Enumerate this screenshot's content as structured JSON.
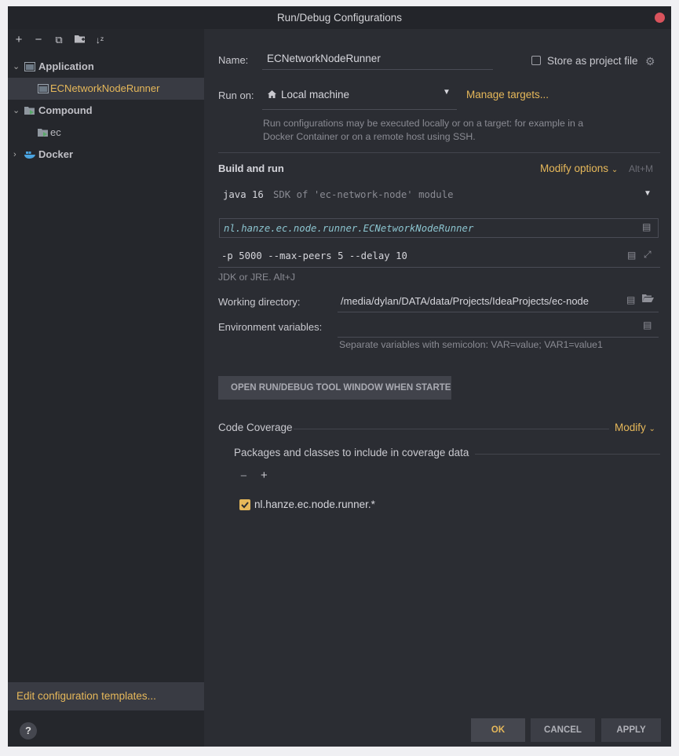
{
  "window": {
    "title": "Run/Debug Configurations"
  },
  "toolbar": {
    "add": "+",
    "remove": "−",
    "copy": "⧉",
    "folder": "▰",
    "sort": "↓ᶻ"
  },
  "tree": [
    {
      "label": "Application",
      "expanded": true
    },
    {
      "label": "ECNetworkNodeRunner",
      "selected": true
    },
    {
      "label": "Compound",
      "expanded": true
    },
    {
      "label": "ec"
    },
    {
      "label": "Docker",
      "expanded": false
    }
  ],
  "sidebar": {
    "edit_templates": "Edit configuration templates...",
    "help": "?"
  },
  "form": {
    "name_label": "Name:",
    "name_value": "ECNetworkNodeRunner",
    "store_label": "Store as project file",
    "run_on_label": "Run on:",
    "run_on_value": "Local machine",
    "manage_targets": "Manage targets...",
    "run_on_hint": "Run configurations may be executed locally or on a target: for example in a Docker Container or on a remote host using SSH.",
    "build_run_title": "Build and run",
    "modify_options": "Modify options",
    "modify_shortcut": "Alt+M",
    "jdk_value": "java 16",
    "jdk_sdk": "SDK of 'ec-network-node' module",
    "main_class": "nl.hanze.ec.node.runner.ECNetworkNodeRunner",
    "program_args": "-p 5000 --max-peers 5 --delay 10",
    "jdk_hint": "JDK or JRE. Alt+J",
    "workdir_label": "Working directory:",
    "workdir_value": "/media/dylan/DATA/data/Projects/IdeaProjects/ec-node",
    "env_label": "Environment variables:",
    "env_value": "",
    "env_hint": "Separate variables with semicolon: VAR=value; VAR1=value1",
    "open_tool_window": "OPEN RUN/DEBUG TOOL WINDOW WHEN STARTED",
    "coverage_title": "Code Coverage",
    "coverage_modify": "Modify",
    "coverage_packages_title": "Packages and classes to include in coverage data",
    "coverage_entry": "nl.hanze.ec.node.runner.*"
  },
  "buttons": {
    "ok": "OK",
    "cancel": "CANCEL",
    "apply": "APPLY"
  },
  "colors": {
    "accent": "#e6b85a",
    "background": "#2b2d33",
    "sidebar": "#25272c",
    "selection": "#393b43"
  }
}
